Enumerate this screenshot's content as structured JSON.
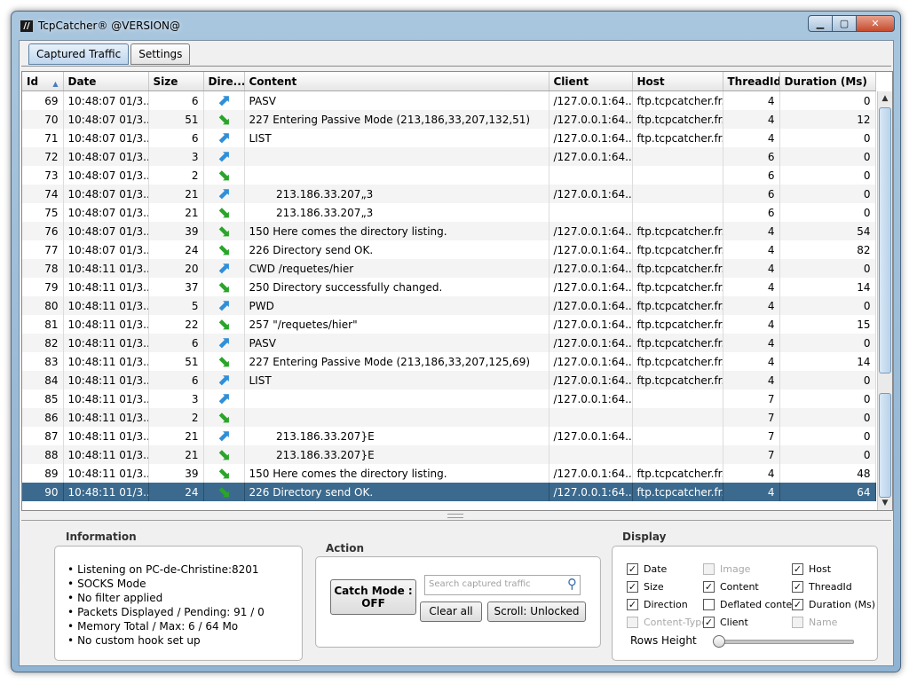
{
  "window": {
    "title": "TcpCatcher®  @VERSION@",
    "app_icon_label": "//"
  },
  "window_buttons": {
    "minimize": "▁",
    "maximize": "▢",
    "close": "✕"
  },
  "tabs": [
    {
      "label": "Captured Traffic",
      "active": true
    },
    {
      "label": "Settings",
      "active": false
    }
  ],
  "table": {
    "columns": [
      "Id",
      "Date",
      "Size",
      "Dire...",
      "Content",
      "Client",
      "Host",
      "ThreadId",
      "Duration (Ms)"
    ],
    "sort_indicator": "▲",
    "rows": [
      {
        "id": "69",
        "date": "10:48:07 01/3...",
        "size": "6",
        "dir": "out",
        "content": "PASV",
        "client": "/127.0.0.1:64...",
        "host": "ftp.tcpcatcher.fr...",
        "thread": "4",
        "duration": "0"
      },
      {
        "id": "70",
        "date": "10:48:07 01/3...",
        "size": "51",
        "dir": "in",
        "content": "227 Entering Passive Mode (213,186,33,207,132,51)",
        "client": "/127.0.0.1:64...",
        "host": "ftp.tcpcatcher.fr...",
        "thread": "4",
        "duration": "12"
      },
      {
        "id": "71",
        "date": "10:48:07 01/3...",
        "size": "6",
        "dir": "out",
        "content": "LIST",
        "client": "/127.0.0.1:64...",
        "host": "ftp.tcpcatcher.fr...",
        "thread": "4",
        "duration": "0"
      },
      {
        "id": "72",
        "date": "10:48:07 01/3...",
        "size": "3",
        "dir": "out",
        "content": "",
        "client": "/127.0.0.1:64...",
        "host": "",
        "thread": "6",
        "duration": "0"
      },
      {
        "id": "73",
        "date": "10:48:07 01/3...",
        "size": "2",
        "dir": "in",
        "content": "",
        "client": "",
        "host": "",
        "thread": "6",
        "duration": "0"
      },
      {
        "id": "74",
        "date": "10:48:07 01/3...",
        "size": "21",
        "dir": "out",
        "content": "        213.186.33.207„3",
        "client": "/127.0.0.1:64...",
        "host": "",
        "thread": "6",
        "duration": "0"
      },
      {
        "id": "75",
        "date": "10:48:07 01/3...",
        "size": "21",
        "dir": "in",
        "content": "        213.186.33.207„3",
        "client": "",
        "host": "",
        "thread": "6",
        "duration": "0"
      },
      {
        "id": "76",
        "date": "10:48:07 01/3...",
        "size": "39",
        "dir": "in",
        "content": "150 Here comes the directory listing.",
        "client": "/127.0.0.1:64...",
        "host": "ftp.tcpcatcher.fr...",
        "thread": "4",
        "duration": "54"
      },
      {
        "id": "77",
        "date": "10:48:07 01/3...",
        "size": "24",
        "dir": "in",
        "content": "226 Directory send OK.",
        "client": "/127.0.0.1:64...",
        "host": "ftp.tcpcatcher.fr...",
        "thread": "4",
        "duration": "82"
      },
      {
        "id": "78",
        "date": "10:48:11 01/3...",
        "size": "20",
        "dir": "out",
        "content": "CWD /requetes/hier",
        "client": "/127.0.0.1:64...",
        "host": "ftp.tcpcatcher.fr...",
        "thread": "4",
        "duration": "0"
      },
      {
        "id": "79",
        "date": "10:48:11 01/3...",
        "size": "37",
        "dir": "in",
        "content": "250 Directory successfully changed.",
        "client": "/127.0.0.1:64...",
        "host": "ftp.tcpcatcher.fr...",
        "thread": "4",
        "duration": "14"
      },
      {
        "id": "80",
        "date": "10:48:11 01/3...",
        "size": "5",
        "dir": "out",
        "content": "PWD",
        "client": "/127.0.0.1:64...",
        "host": "ftp.tcpcatcher.fr...",
        "thread": "4",
        "duration": "0"
      },
      {
        "id": "81",
        "date": "10:48:11 01/3...",
        "size": "22",
        "dir": "in",
        "content": "257 \"/requetes/hier\"",
        "client": "/127.0.0.1:64...",
        "host": "ftp.tcpcatcher.fr...",
        "thread": "4",
        "duration": "15"
      },
      {
        "id": "82",
        "date": "10:48:11 01/3...",
        "size": "6",
        "dir": "out",
        "content": "PASV",
        "client": "/127.0.0.1:64...",
        "host": "ftp.tcpcatcher.fr...",
        "thread": "4",
        "duration": "0"
      },
      {
        "id": "83",
        "date": "10:48:11 01/3...",
        "size": "51",
        "dir": "in",
        "content": "227 Entering Passive Mode (213,186,33,207,125,69)",
        "client": "/127.0.0.1:64...",
        "host": "ftp.tcpcatcher.fr...",
        "thread": "4",
        "duration": "14"
      },
      {
        "id": "84",
        "date": "10:48:11 01/3...",
        "size": "6",
        "dir": "out",
        "content": "LIST",
        "client": "/127.0.0.1:64...",
        "host": "ftp.tcpcatcher.fr...",
        "thread": "4",
        "duration": "0"
      },
      {
        "id": "85",
        "date": "10:48:11 01/3...",
        "size": "3",
        "dir": "out",
        "content": "",
        "client": "/127.0.0.1:64...",
        "host": "",
        "thread": "7",
        "duration": "0"
      },
      {
        "id": "86",
        "date": "10:48:11 01/3...",
        "size": "2",
        "dir": "in",
        "content": "",
        "client": "",
        "host": "",
        "thread": "7",
        "duration": "0"
      },
      {
        "id": "87",
        "date": "10:48:11 01/3...",
        "size": "21",
        "dir": "out",
        "content": "        213.186.33.207}E",
        "client": "/127.0.0.1:64...",
        "host": "",
        "thread": "7",
        "duration": "0"
      },
      {
        "id": "88",
        "date": "10:48:11 01/3...",
        "size": "21",
        "dir": "in",
        "content": "        213.186.33.207}E",
        "client": "",
        "host": "",
        "thread": "7",
        "duration": "0"
      },
      {
        "id": "89",
        "date": "10:48:11 01/3...",
        "size": "39",
        "dir": "in",
        "content": "150 Here comes the directory listing.",
        "client": "/127.0.0.1:64...",
        "host": "ftp.tcpcatcher.fr...",
        "thread": "4",
        "duration": "48"
      },
      {
        "id": "90",
        "date": "10:48:11 01/3...",
        "size": "24",
        "dir": "in",
        "content": "226 Directory send OK.",
        "client": "/127.0.0.1:64...",
        "host": "ftp.tcpcatcher.fr...",
        "thread": "4",
        "duration": "64",
        "selected": true
      }
    ]
  },
  "arrow_glyphs": {
    "out": "⬈",
    "in": "⬊"
  },
  "scrollbar": {
    "up": "▲",
    "down": "▼"
  },
  "information": {
    "title": "Information",
    "items": [
      "Listening on PC-de-Christine:8201",
      "SOCKS Mode",
      "No filter applied",
      "Packets Displayed / Pending: 91 / 0",
      "Memory Total / Max: 6 / 64 Mo",
      "No custom hook set up"
    ]
  },
  "action": {
    "title": "Action",
    "catch_mode_line1": "Catch Mode :",
    "catch_mode_line2": "OFF",
    "search_placeholder": "Search captured traffic",
    "clear_all": "Clear all",
    "scroll": "Scroll: Unlocked"
  },
  "display": {
    "title": "Display",
    "checkboxes": [
      {
        "label": "Date",
        "checked": true,
        "enabled": true
      },
      {
        "label": "Image",
        "checked": false,
        "enabled": false
      },
      {
        "label": "Host",
        "checked": true,
        "enabled": true
      },
      {
        "label": "Size",
        "checked": true,
        "enabled": true
      },
      {
        "label": "Content",
        "checked": true,
        "enabled": true
      },
      {
        "label": "ThreadId",
        "checked": true,
        "enabled": true
      },
      {
        "label": "Direction",
        "checked": true,
        "enabled": true
      },
      {
        "label": "Deflated content",
        "checked": false,
        "enabled": true
      },
      {
        "label": "Duration (Ms)",
        "checked": true,
        "enabled": true
      },
      {
        "label": "Content-Type",
        "checked": false,
        "enabled": false
      },
      {
        "label": "Client",
        "checked": true,
        "enabled": true
      },
      {
        "label": "Name",
        "checked": false,
        "enabled": false
      }
    ],
    "rows_height_label": "Rows Height",
    "rows_height_value": 0
  },
  "check_glyph": "✓"
}
